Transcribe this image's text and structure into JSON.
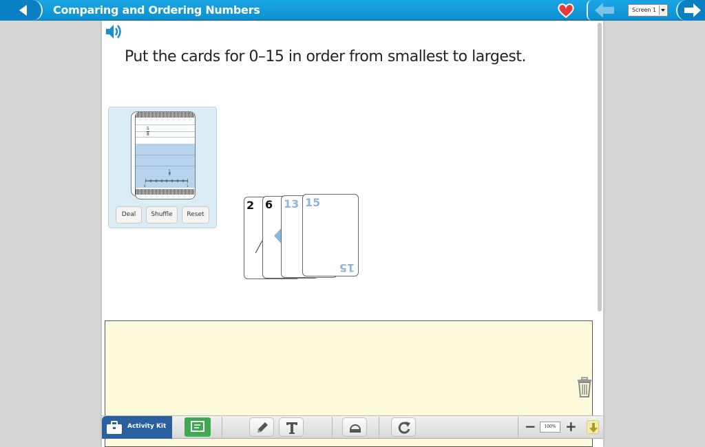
{
  "header": {
    "title": "Comparing and Ordering Numbers",
    "screen_select": "Screen 1",
    "colors": {
      "bar": "#1aa6e4",
      "heart": "#e63b3b"
    },
    "icons": [
      "back-arrow-icon",
      "heart-icon",
      "prev-arrow-icon",
      "next-arrow-icon"
    ]
  },
  "main": {
    "prompt": "Put the cards for 0–15 in order from smallest to largest.",
    "deck": {
      "fraction": {
        "numerator": "5",
        "denominator": "8"
      },
      "small_fraction": {
        "numerator": "5",
        "denominator": "8"
      },
      "tick_start": "0",
      "tick_end": "1",
      "buttons": {
        "deal": "Deal",
        "shuffle": "Shuffle",
        "reset": "Reset"
      }
    },
    "cards": [
      {
        "value": "2",
        "color": "#111111"
      },
      {
        "value": "6",
        "color": "#111111"
      },
      {
        "value": "13",
        "color": "#8fb6d9"
      },
      {
        "value": "15",
        "color": "#8fb6d9"
      }
    ]
  },
  "toolbar": {
    "activity_kit": "Activity Kit",
    "zoom": "100%",
    "zoom_out": "−",
    "zoom_in": "+"
  }
}
